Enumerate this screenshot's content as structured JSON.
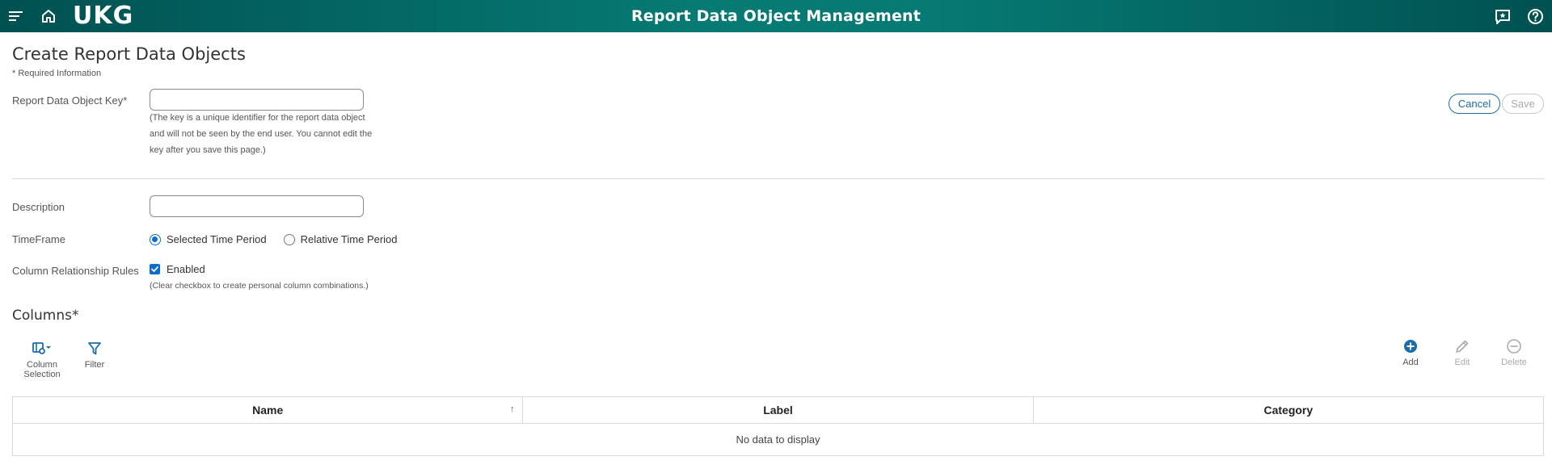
{
  "header": {
    "logo": "UKG",
    "title": "Report Data Object Management",
    "gradient_edge": "#005151",
    "gradient_center": "#077a73"
  },
  "page": {
    "title": "Create Report Data Objects",
    "required_note": "* Required Information"
  },
  "actions": {
    "cancel_label": "Cancel",
    "save_label": "Save",
    "accent": "#1b6ca8"
  },
  "form": {
    "key": {
      "label": "Report Data Object Key*",
      "value": "",
      "hint_lines": [
        "(The key is a unique identifier for the report data object",
        "and will not be seen by the end user. You cannot edit the",
        "key after you save this page.)"
      ]
    },
    "description": {
      "label": "Description",
      "value": ""
    },
    "timeframe": {
      "label": "TimeFrame",
      "options": [
        {
          "label": "Selected Time Period",
          "checked": true
        },
        {
          "label": "Relative Time Period",
          "checked": false
        }
      ]
    },
    "column_rules": {
      "label": "Column Relationship Rules",
      "checkbox_label": "Enabled",
      "checked": true,
      "hint": "(Clear checkbox to create personal column combinations.)"
    }
  },
  "columns": {
    "title": "Columns*",
    "toolbar_left": [
      {
        "label_line1": "Column",
        "label_line2": "Selection",
        "icon": "column-selection-icon"
      },
      {
        "label_line1": "Filter",
        "label_line2": "",
        "icon": "filter-icon"
      }
    ],
    "toolbar_right": [
      {
        "label": "Add",
        "icon": "add-icon",
        "enabled": true
      },
      {
        "label": "Edit",
        "icon": "edit-icon",
        "enabled": false
      },
      {
        "label": "Delete",
        "icon": "delete-icon",
        "enabled": false
      }
    ],
    "table": {
      "headers": [
        "Name",
        "Label",
        "Category"
      ],
      "sort_indicator": "↑",
      "empty_message": "No data to display"
    }
  }
}
